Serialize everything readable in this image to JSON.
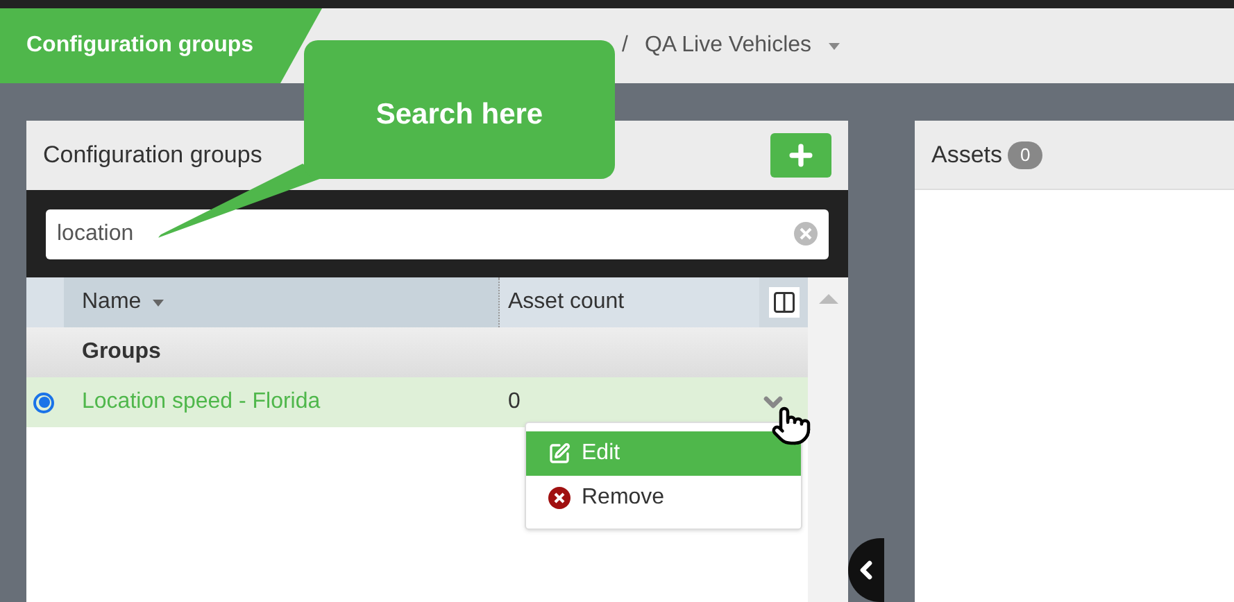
{
  "header": {
    "title": "Configuration groups",
    "breadcrumb": [
      {
        "label": "/"
      },
      {
        "label": "QA Live Vehicles"
      }
    ]
  },
  "callout": {
    "text": "Search here"
  },
  "left_panel": {
    "title": "Configuration groups",
    "search": {
      "value": "location"
    },
    "table": {
      "columns": [
        "Name",
        "Asset count"
      ],
      "group": "Groups",
      "rows": [
        {
          "name": "Location speed - Florida",
          "asset_count": "0",
          "selected": true
        }
      ]
    },
    "menu": [
      {
        "label": "Edit",
        "kind": "edit",
        "selected": true
      },
      {
        "label": "Remove",
        "kind": "remove",
        "selected": false
      }
    ]
  },
  "right_panel": {
    "title": "Assets",
    "count": "0"
  }
}
